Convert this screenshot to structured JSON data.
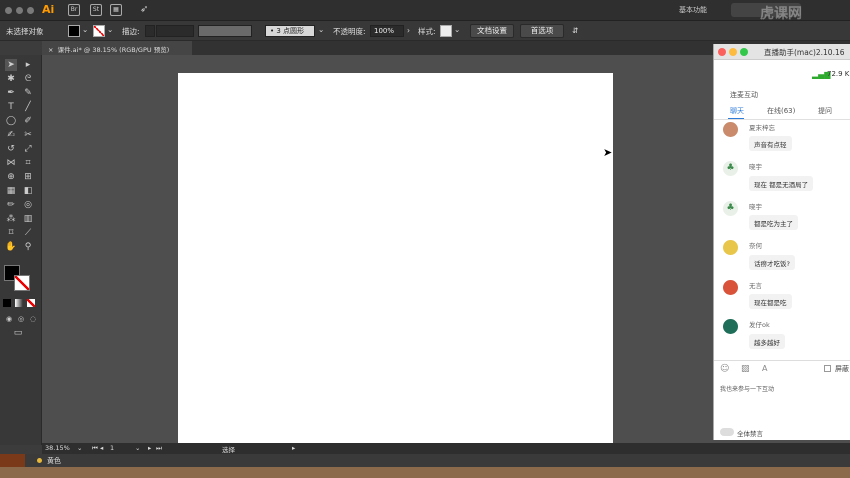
{
  "app": {
    "logo": "Ai",
    "workspace": "基本功能",
    "watermark": "虎课网"
  },
  "control_bar": {
    "selection": "未选择对象",
    "stroke_label": "描边:",
    "brush": "3 点圆形",
    "opacity_label": "不透明度:",
    "opacity_value": "100%",
    "style_label": "样式:",
    "doc_settings": "文档设置",
    "preferences": "首选项"
  },
  "document_tab": {
    "title": "课件.ai* @ 38.15% (RGB/GPU 预览)"
  },
  "status_bar": {
    "zoom": "38.15%",
    "page": "1",
    "tool": "选择"
  },
  "layer": {
    "color_name": "黄色"
  },
  "chat": {
    "title": "直播助手(mac)2.10.16",
    "network": "72.9 K",
    "section": "连麦互动",
    "tabs": [
      "聊天",
      "在线(63)",
      "提问"
    ],
    "messages": [
      {
        "name": "夏末梓忘",
        "text": "声音有点轻",
        "avatar_color": "#c98b6b"
      },
      {
        "name": "晓宇",
        "text": "现在 都是无酒局了",
        "avatar_color": "#6aa87a"
      },
      {
        "name": "晓宇",
        "text": "都是吃为主了",
        "avatar_color": "#6aa87a"
      },
      {
        "name": "奈何",
        "text": "话痨才吃饭?",
        "avatar_color": "#e8c64a"
      },
      {
        "name": "无言",
        "text": "现在都是吃",
        "avatar_color": "#d9533a"
      },
      {
        "name": "发仔ok",
        "text": "越多越好",
        "avatar_color": "#1f6e5a"
      }
    ],
    "input_placeholder": "我也来参与一下互动",
    "screen_label": "屏蔽",
    "mute_all": "全体禁言"
  }
}
